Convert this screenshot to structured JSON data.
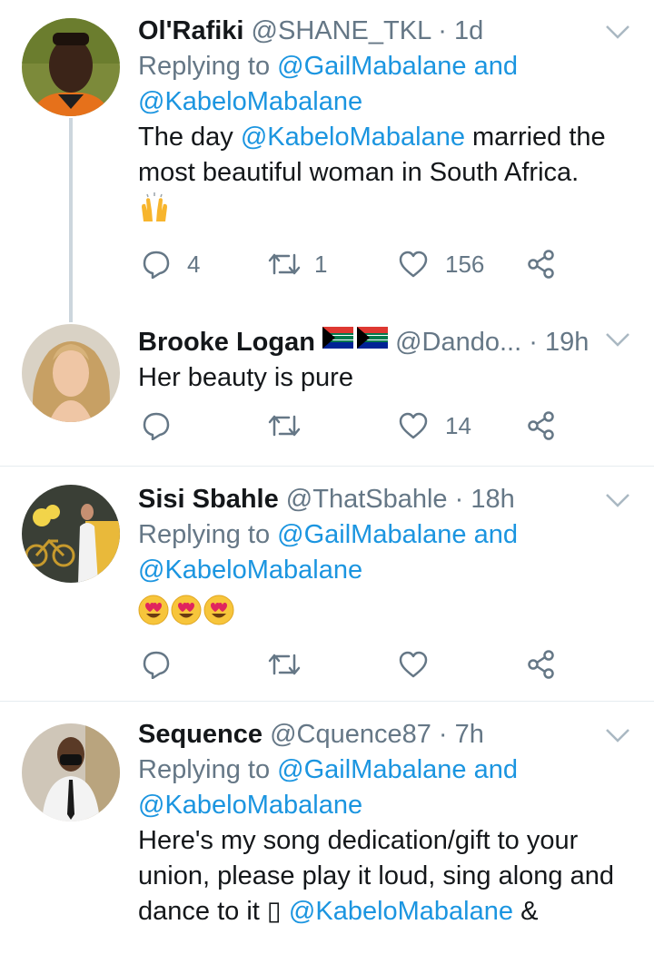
{
  "tweets": [
    {
      "name": "Ol'Rafiki",
      "handle": "@SHANE_TKL",
      "time": "1d",
      "reply_prefix": "Replying to ",
      "reply_mention_1": "@GailMabalane",
      "reply_and": " and",
      "reply_mention_2": "@KabeloMabalane",
      "text_pre": "The day ",
      "text_mention": "@KabeloMabalane",
      "text_post": " married the most beautiful woman in South Africa.",
      "emoji": "raising-hands",
      "replies": "4",
      "retweets": "1",
      "likes": "156"
    },
    {
      "name": "Brooke Logan",
      "handle": "@Dando...",
      "time": "19h",
      "flags": "south-africa-flags",
      "text": "Her beauty is pure",
      "replies": "",
      "retweets": "",
      "likes": "14"
    },
    {
      "name": "Sisi Sbahle",
      "handle": "@ThatSbahle",
      "time": "18h",
      "reply_prefix": "Replying to ",
      "reply_mention_1": "@GailMabalane",
      "reply_and": " and",
      "reply_mention_2": "@KabeloMabalane",
      "emoji": "heart-eyes x3",
      "replies": "",
      "retweets": "",
      "likes": ""
    },
    {
      "name": "Sequence",
      "handle": "@Cquence87",
      "time": "7h",
      "reply_prefix": "Replying to ",
      "reply_mention_1": "@GailMabalane",
      "reply_and": " and",
      "reply_mention_2": "@KabeloMabalane",
      "text_line1": "Here's my song dedication/gift to your",
      "text_line2": "union, please play it loud, sing along and",
      "text_line3_pre": "dance to it ",
      "text_line3_glyph": "▯",
      "text_line3_mention": "@KabeloMabalane",
      "text_line3_post": " &"
    }
  ],
  "separator": "·",
  "colors": {
    "link": "#1b95e0",
    "muted": "#657786",
    "divider": "#e6ecf0",
    "text": "#14171a"
  }
}
